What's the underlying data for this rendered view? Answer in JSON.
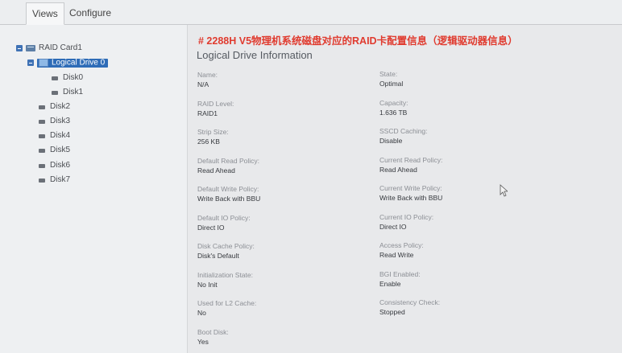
{
  "tabs": [
    {
      "label": "Views",
      "active": true
    },
    {
      "label": "Configure",
      "active": false
    }
  ],
  "tree": {
    "root": {
      "label": "RAID Card1",
      "icon": "raid-card-icon"
    },
    "logical_drive": {
      "label": "Logical Drive 0",
      "icon": "logical-drive-icon",
      "selected": true
    },
    "ld_disks": [
      "Disk0",
      "Disk1"
    ],
    "disks": [
      "Disk2",
      "Disk3",
      "Disk4",
      "Disk5",
      "Disk6",
      "Disk7"
    ]
  },
  "annotation": "# 2288H V5物理机系统磁盘对应的RAID卡配置信息（逻辑驱动器信息）",
  "section_title": "Logical Drive Information",
  "fields_left": [
    {
      "label": "Name:",
      "value": "N/A"
    },
    {
      "label": "RAID Level:",
      "value": "RAID1"
    },
    {
      "label": "Strip Size:",
      "value": "256 KB"
    },
    {
      "label": "Default Read Policy:",
      "value": "Read Ahead"
    },
    {
      "label": "Default Write Policy:",
      "value": "Write Back with BBU"
    },
    {
      "label": "Default IO Policy:",
      "value": "Direct IO"
    },
    {
      "label": "Disk Cache Policy:",
      "value": "Disk's Default"
    },
    {
      "label": "Initialization State:",
      "value": "No Init"
    },
    {
      "label": "Used for L2 Cache:",
      "value": "No"
    },
    {
      "label": "Boot Disk:",
      "value": "Yes"
    }
  ],
  "fields_right": [
    {
      "label": "State:",
      "value": "Optimal"
    },
    {
      "label": "Capacity:",
      "value": "1.636 TB"
    },
    {
      "label": "SSCD Caching:",
      "value": "Disable"
    },
    {
      "label": "Current Read Policy:",
      "value": "Read Ahead"
    },
    {
      "label": "Current Write Policy:",
      "value": "Write Back with BBU"
    },
    {
      "label": "Current IO Policy:",
      "value": "Direct IO"
    },
    {
      "label": "Access Policy:",
      "value": "Read Write"
    },
    {
      "label": "BGI Enabled:",
      "value": "Enable"
    },
    {
      "label": "Consistency Check:",
      "value": "Stopped"
    }
  ],
  "colors": {
    "selection": "#2e6cb7",
    "annotation": "#e03b2f",
    "expander": "#3f72b5"
  }
}
